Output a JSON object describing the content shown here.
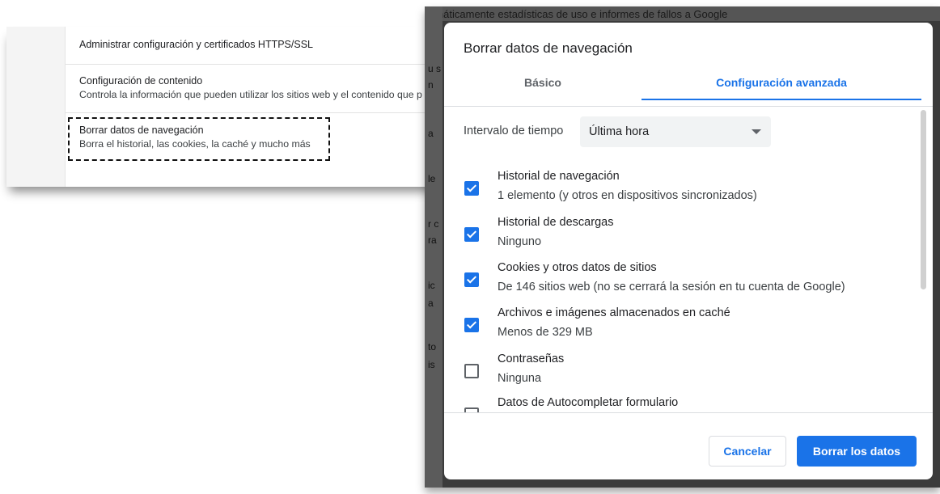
{
  "background_settings": {
    "rows": [
      {
        "title": "Administrar configuración y certificados HTTPS/SSL",
        "subtitle": ""
      },
      {
        "title": "Configuración de contenido",
        "subtitle": "Controla la información que pueden utilizar los sitios web y el contenido que p"
      },
      {
        "title": "Borrar datos de navegación",
        "subtitle": "Borra el historial, las cookies, la caché y mucho más"
      }
    ]
  },
  "behind_dialog_fragments": [
    "u s",
    "n",
    "a",
    "le",
    "r c",
    "ra",
    "ic",
    "a",
    "to",
    "is"
  ],
  "behind_dialog_top": "rmáticamente estadísticas de uso e informes de fallos a Google",
  "dialog": {
    "title": "Borrar datos de navegación",
    "tabs": [
      {
        "label": "Básico",
        "active": false
      },
      {
        "label": "Configuración avanzada",
        "active": true
      }
    ],
    "time_range": {
      "label": "Intervalo de tiempo",
      "value": "Última hora"
    },
    "items": [
      {
        "label": "Historial de navegación",
        "description": "1 elemento (y otros en dispositivos sincronizados)",
        "checked": true
      },
      {
        "label": "Historial de descargas",
        "description": "Ninguno",
        "checked": true
      },
      {
        "label": "Cookies y otros datos de sitios",
        "description": "De 146 sitios web (no se cerrará la sesión en tu cuenta de Google)",
        "checked": true
      },
      {
        "label": "Archivos e imágenes almacenados en caché",
        "description": "Menos de 329 MB",
        "checked": true
      },
      {
        "label": "Contraseñas",
        "description": "Ninguna",
        "checked": false
      },
      {
        "label": "Datos de Autocompletar formulario",
        "description": "",
        "checked": false
      }
    ],
    "buttons": {
      "cancel": "Cancelar",
      "confirm": "Borrar los datos"
    }
  },
  "colors": {
    "accent": "#1a73e8",
    "frame": "#3b3b3b"
  }
}
